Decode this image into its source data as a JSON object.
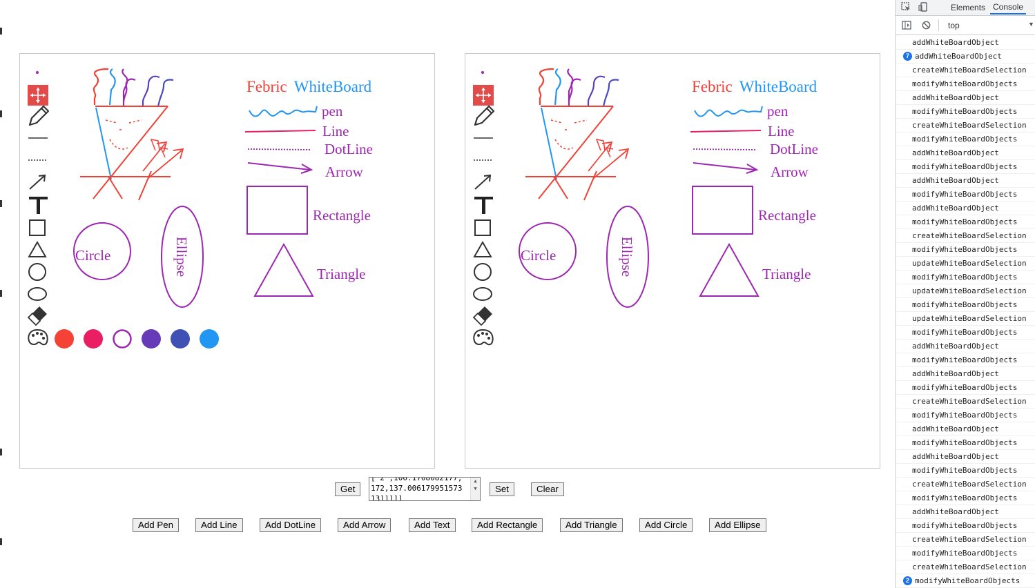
{
  "whiteboard": {
    "title_part1": "Febric",
    "title_part2": "WhiteBoard",
    "labels": {
      "pen": "pen",
      "line": "Line",
      "dotline": "DotLine",
      "arrow": "Arrow",
      "rectangle": "Rectangle",
      "triangle": "Triangle",
      "circle": "Circle",
      "ellipse": "Ellipse"
    },
    "tools": [
      "dot",
      "select",
      "pencil",
      "line",
      "dotted-line",
      "arrow",
      "text",
      "rectangle",
      "triangle",
      "circle",
      "ellipse",
      "eraser",
      "palette"
    ],
    "palette_colors": [
      "#f44336",
      "#e91e63",
      "#9c27b0",
      "#673ab7",
      "#3f51b5",
      "#2196f3"
    ],
    "selected_color": "#9c27b0",
    "colors": {
      "red": "#ef4136",
      "blue": "#2196f3",
      "purple": "#9c27b0",
      "pink_line": "#e91e63"
    }
  },
  "controls": {
    "get_label": "Get",
    "json_text": "[ 2 ,100.1708082177,\n172,137.006179951573\n13]]]]]",
    "set_label": "Set",
    "clear_label": "Clear"
  },
  "add_buttons": [
    "Add Pen",
    "Add Line",
    "Add DotLine",
    "Add Arrow",
    "Add Text",
    "Add Rectangle",
    "Add Triangle",
    "Add Circle",
    "Add Ellipse"
  ],
  "devtools": {
    "tabs": [
      "Elements",
      "Console"
    ],
    "active_tab": "Console",
    "context": "top",
    "logs": [
      {
        "text": "addWhiteBoardObject"
      },
      {
        "text": "addWhiteBoardObject",
        "count": "7"
      },
      {
        "text": "createWhiteBoardSelection"
      },
      {
        "text": "modifyWhiteBoardObjects"
      },
      {
        "text": "addWhiteBoardObject"
      },
      {
        "text": "modifyWhiteBoardObjects"
      },
      {
        "text": "createWhiteBoardSelection"
      },
      {
        "text": "modifyWhiteBoardObjects"
      },
      {
        "text": "addWhiteBoardObject"
      },
      {
        "text": "modifyWhiteBoardObjects"
      },
      {
        "text": "addWhiteBoardObject"
      },
      {
        "text": "modifyWhiteBoardObjects"
      },
      {
        "text": "addWhiteBoardObject"
      },
      {
        "text": "modifyWhiteBoardObjects"
      },
      {
        "text": "createWhiteBoardSelection"
      },
      {
        "text": "modifyWhiteBoardObjects"
      },
      {
        "text": "updateWhiteBoardSelection"
      },
      {
        "text": "modifyWhiteBoardObjects"
      },
      {
        "text": "updateWhiteBoardSelection"
      },
      {
        "text": "modifyWhiteBoardObjects"
      },
      {
        "text": "updateWhiteBoardSelection"
      },
      {
        "text": "modifyWhiteBoardObjects"
      },
      {
        "text": "addWhiteBoardObject"
      },
      {
        "text": "modifyWhiteBoardObjects"
      },
      {
        "text": "addWhiteBoardObject"
      },
      {
        "text": "modifyWhiteBoardObjects"
      },
      {
        "text": "createWhiteBoardSelection"
      },
      {
        "text": "modifyWhiteBoardObjects"
      },
      {
        "text": "addWhiteBoardObject"
      },
      {
        "text": "modifyWhiteBoardObjects"
      },
      {
        "text": "addWhiteBoardObject"
      },
      {
        "text": "modifyWhiteBoardObjects"
      },
      {
        "text": "createWhiteBoardSelection"
      },
      {
        "text": "modifyWhiteBoardObjects"
      },
      {
        "text": "addWhiteBoardObject"
      },
      {
        "text": "modifyWhiteBoardObjects"
      },
      {
        "text": "createWhiteBoardSelection"
      },
      {
        "text": "modifyWhiteBoardObjects"
      },
      {
        "text": "createWhiteBoardSelection"
      },
      {
        "text": "modifyWhiteBoardObjects",
        "count": "2"
      }
    ]
  }
}
